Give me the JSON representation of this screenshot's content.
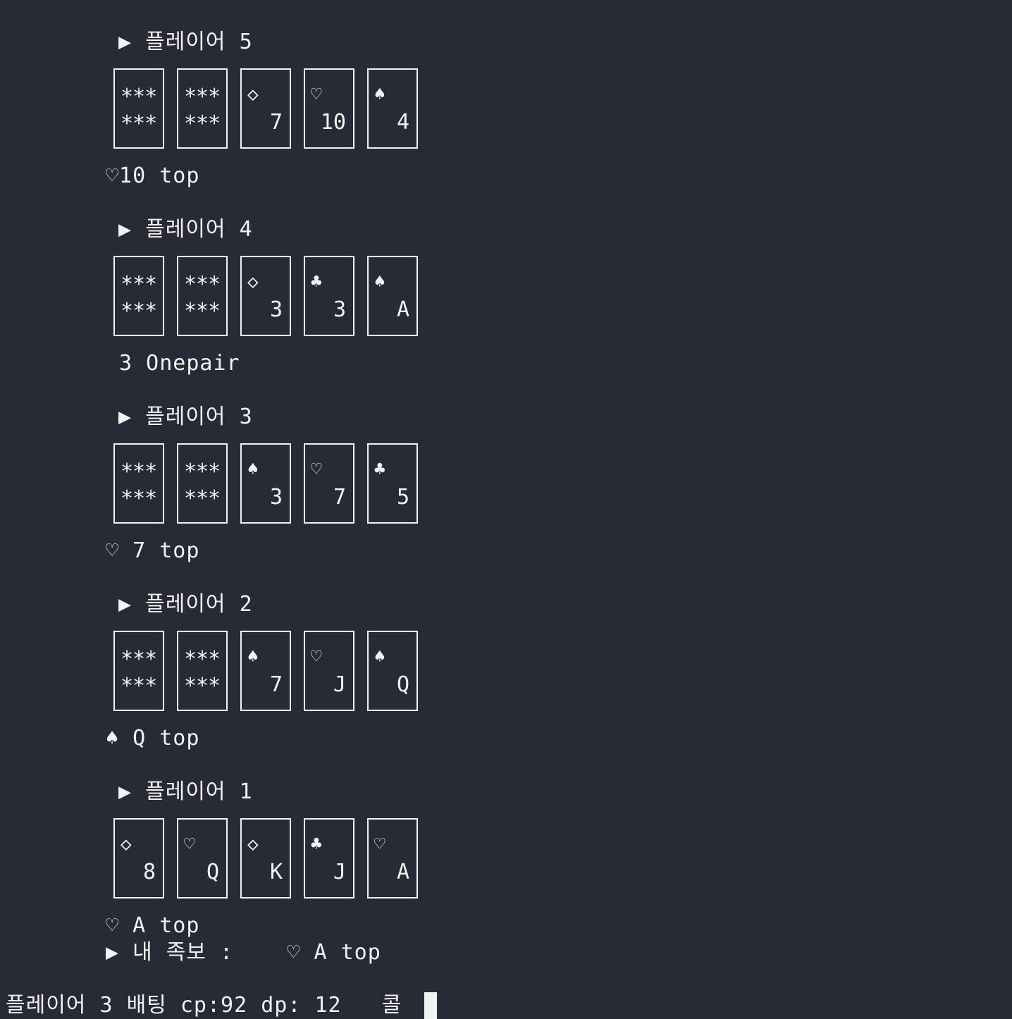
{
  "players": [
    {
      "header": "▶ 플레이어 5",
      "cards": [
        {
          "hidden": true,
          "back_top": "***",
          "back_bottom": "***"
        },
        {
          "hidden": true,
          "back_top": "***",
          "back_bottom": "***"
        },
        {
          "suit": "◇",
          "rank": "7"
        },
        {
          "suit": "♡",
          "rank": "10"
        },
        {
          "suit": "♠",
          "rank": "4"
        }
      ],
      "hand": "♡10 top"
    },
    {
      "header": "▶ 플레이어 4",
      "cards": [
        {
          "hidden": true,
          "back_top": "***",
          "back_bottom": "***"
        },
        {
          "hidden": true,
          "back_top": "***",
          "back_bottom": "***"
        },
        {
          "suit": "◇",
          "rank": "3"
        },
        {
          "suit": "♣",
          "rank": "3"
        },
        {
          "suit": "♠",
          "rank": "A"
        }
      ],
      "hand": " 3 Onepair"
    },
    {
      "header": "▶ 플레이어 3",
      "cards": [
        {
          "hidden": true,
          "back_top": "***",
          "back_bottom": "***"
        },
        {
          "hidden": true,
          "back_top": "***",
          "back_bottom": "***"
        },
        {
          "suit": "♠",
          "rank": "3"
        },
        {
          "suit": "♡",
          "rank": "7"
        },
        {
          "suit": "♣",
          "rank": "5"
        }
      ],
      "hand": "♡ 7 top"
    },
    {
      "header": "▶ 플레이어 2",
      "cards": [
        {
          "hidden": true,
          "back_top": "***",
          "back_bottom": "***"
        },
        {
          "hidden": true,
          "back_top": "***",
          "back_bottom": "***"
        },
        {
          "suit": "♠",
          "rank": "7"
        },
        {
          "suit": "♡",
          "rank": "J"
        },
        {
          "suit": "♠",
          "rank": "Q"
        }
      ],
      "hand": "♠ Q top"
    },
    {
      "header": "▶ 플레이어 1",
      "cards": [
        {
          "suit": "◇",
          "rank": "8"
        },
        {
          "suit": "♡",
          "rank": "Q"
        },
        {
          "suit": "◇",
          "rank": "K"
        },
        {
          "suit": "♣",
          "rank": "J"
        },
        {
          "suit": "♡",
          "rank": "A"
        }
      ],
      "hand": "♡ A top"
    }
  ],
  "my_hand_line": "▶ 내 족보 :    ♡ A top",
  "prompt_line": "플레이어 3 배팅 cp:92 dp: 12   콜"
}
